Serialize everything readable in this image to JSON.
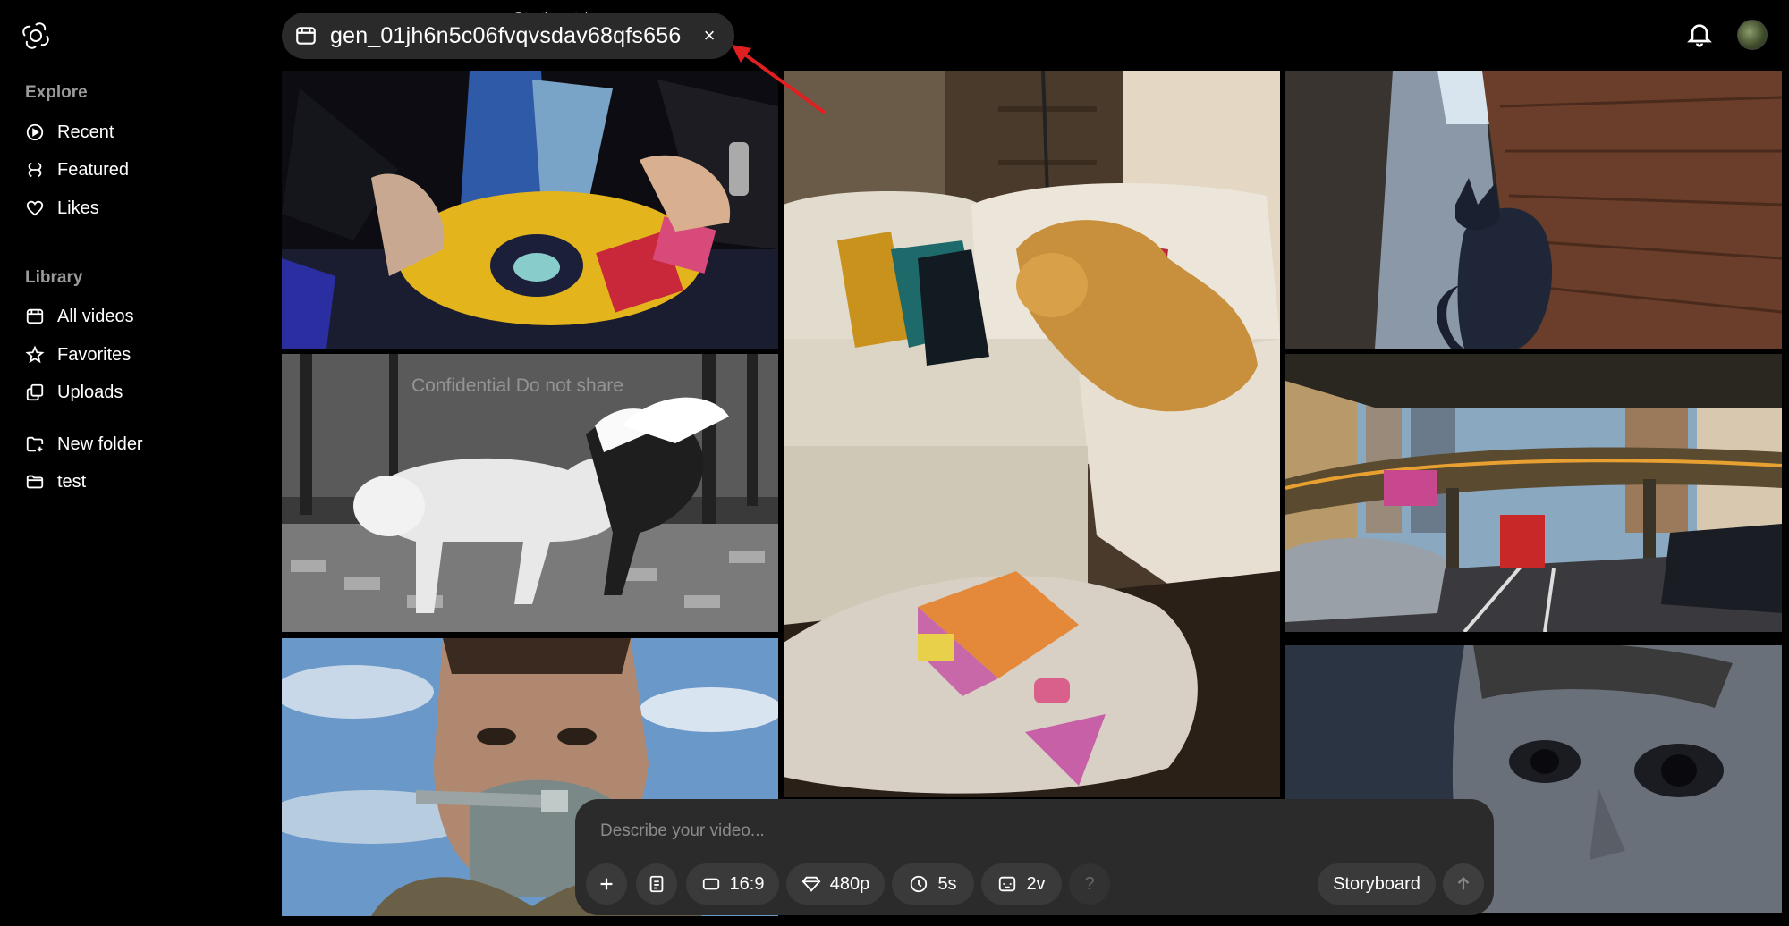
{
  "topbar": {
    "generation_id": "gen_01jh6n5c06fvqvsdav68qfs656",
    "close_label": "×",
    "watermark": "@testingcatalog"
  },
  "sidebar": {
    "explore_title": "Explore",
    "explore_items": [
      {
        "label": "Recent",
        "icon": "play-circle-icon"
      },
      {
        "label": "Featured",
        "icon": "featured-icon"
      },
      {
        "label": "Likes",
        "icon": "heart-icon"
      }
    ],
    "library_title": "Library",
    "library_items": [
      {
        "label": "All videos",
        "icon": "video-icon"
      },
      {
        "label": "Favorites",
        "icon": "star-icon"
      },
      {
        "label": "Uploads",
        "icon": "uploads-icon"
      }
    ],
    "folder_items": [
      {
        "label": "New folder",
        "icon": "new-folder-icon"
      },
      {
        "label": "test",
        "icon": "folder-icon"
      }
    ]
  },
  "grid": {
    "overlay_text": "Confidential  Do not share"
  },
  "composer": {
    "placeholder": "Describe your video...",
    "aspect_ratio": "16:9",
    "resolution": "480p",
    "duration": "5s",
    "variations": "2v",
    "help_label": "?",
    "storyboard_label": "Storyboard"
  },
  "colors": {
    "background": "#000000",
    "chip": "#2a2a2a",
    "composer": "#2b2b2b",
    "annotation_arrow": "#e02020"
  }
}
